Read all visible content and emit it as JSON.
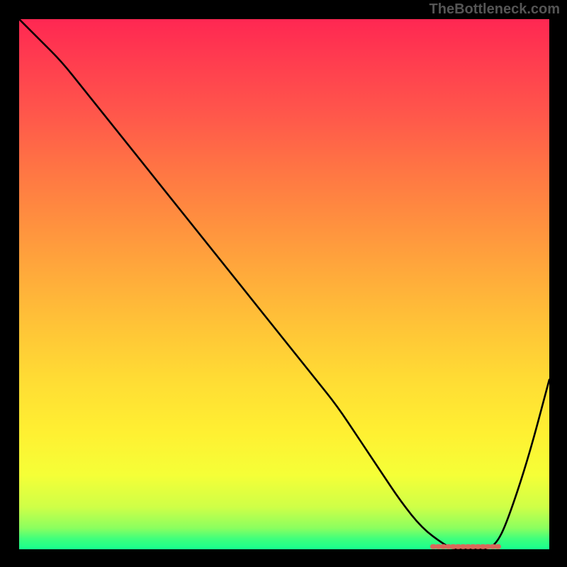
{
  "watermark": "TheBottleneck.com",
  "colors": {
    "background": "#000000",
    "curve": "#000000",
    "bottom_accent": "#d9685a",
    "gradient_top": "#ff2752",
    "gradient_bottom": "#17ff8e"
  },
  "chart_data": {
    "type": "line",
    "title": "",
    "xlabel": "",
    "ylabel": "",
    "xlim": [
      0,
      100
    ],
    "ylim": [
      0,
      100
    ],
    "grid": false,
    "legend": false,
    "series": [
      {
        "name": "bottleneck-curve",
        "x": [
          0,
          4,
          8,
          12,
          16,
          20,
          24,
          28,
          32,
          36,
          40,
          44,
          48,
          52,
          56,
          60,
          64,
          68,
          72,
          76,
          80,
          82,
          84,
          86,
          88,
          90,
          92,
          96,
          100
        ],
        "values": [
          100,
          96,
          92,
          87,
          82,
          77,
          72,
          67,
          62,
          57,
          52,
          47,
          42,
          37,
          32,
          27,
          21,
          15,
          9,
          4,
          1,
          0,
          0,
          0,
          0,
          1,
          5,
          17,
          32
        ]
      }
    ],
    "bottom_accent_range": {
      "start_x": 78,
      "end_x": 91,
      "y": 0.5
    }
  }
}
